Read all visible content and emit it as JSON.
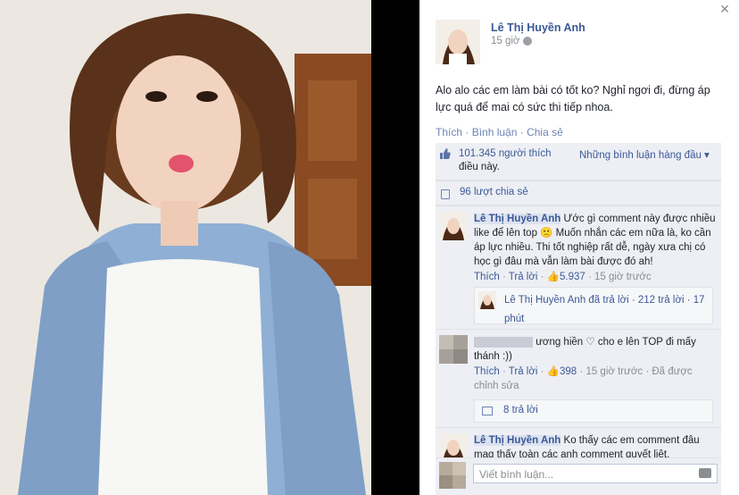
{
  "photo": {
    "description_icon": "portrait-photo"
  },
  "close": {
    "glyph": "✕"
  },
  "post": {
    "author": "Lê Thị Huyền Anh",
    "time": "15 giờ",
    "text": "Alo alo các em làm bài có tốt ko? Nghỉ ngơi đi, đừng áp lực quá để mai có sức thi tiếp nhoa.",
    "actions": {
      "like": "Thích",
      "comment": "Bình luận",
      "share": "Chia sẻ",
      "sep": " · "
    }
  },
  "ufi": {
    "likes": "101.345 người thích",
    "likes_suffix": "điều này.",
    "top_comments": "Những bình luận hàng đầu ▾",
    "shares": "96 lượt chia sẻ"
  },
  "comments": [
    {
      "name": "Lê Thị Huyền Anh",
      "text": " Ước gì comment này được nhiều like để lên top 🙁 Muốn nhắn các em nữa là, ko cần áp lực nhiều. Thi tốt nghiệp rất dễ, ngày xưa chị có học gì đâu mà vẫn làm bài được đó ah!",
      "meta": {
        "like": "Thích",
        "reply": "Trả lời",
        "likes": "5.937",
        "time": "15 giờ trước"
      },
      "reply_summary": {
        "name": "Lê Thị Huyền Anh",
        "text": " đã trả lời · 212 trả lời · 17 phút"
      }
    },
    {
      "name": "",
      "text": "ương hiền ♡ cho e lên TOP đi mấy thánh :))",
      "meta": {
        "like": "Thích",
        "reply": "Trả lời",
        "likes": "398",
        "time": "15 giờ trước",
        "edited": "Đã được chỉnh sửa"
      },
      "reply_summary": {
        "text": "8 trả lời"
      }
    },
    {
      "name": "Lê Thị Huyền Anh",
      "text": " Ko thấy các em comment đâu mag thấy toàn các anh comment quyết liệt."
    }
  ],
  "composer": {
    "placeholder": "Viết bình luận..."
  },
  "colors": {
    "link": "#3b5998",
    "ufi_bg": "#edeff4",
    "meta": "#8a8d91"
  }
}
